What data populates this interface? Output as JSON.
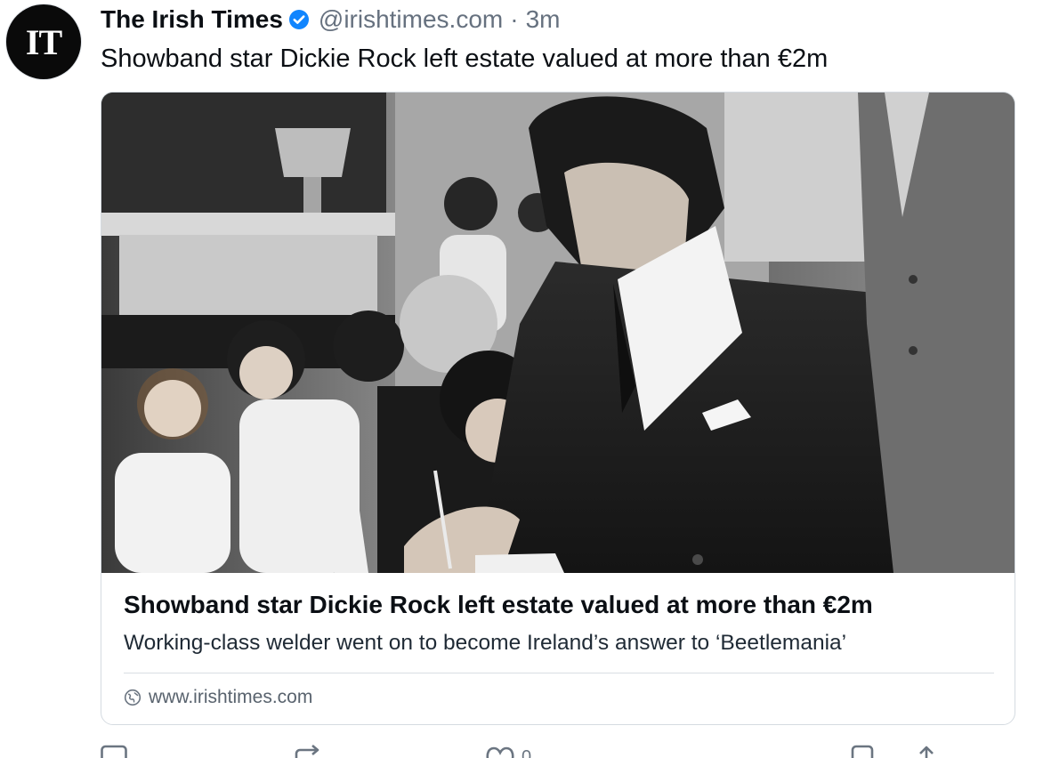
{
  "post": {
    "author_name": "The Irish Times",
    "handle": "@irishtimes.com",
    "separator": "·",
    "time": "3m",
    "avatar_text": "IT",
    "text": "Showband star Dickie Rock left estate valued at more than €2m"
  },
  "icons": {
    "verified": "verified-badge-icon",
    "domain": "globe-icon",
    "reply": "reply-icon",
    "repost": "repost-icon",
    "like": "heart-icon",
    "bookmark": "bookmark-icon",
    "share": "share-icon"
  },
  "colors": {
    "verified": "#1185fe",
    "muted_text": "#66717f",
    "card_border": "#d5dbe1"
  },
  "link_card": {
    "title": "Showband star Dickie Rock left estate valued at more than €2m",
    "description": "Working-class welder went on to become Ireland’s answer to ‘Beetlemania’",
    "domain": "www.irishtimes.com"
  },
  "actions": {
    "like_count": "0"
  }
}
